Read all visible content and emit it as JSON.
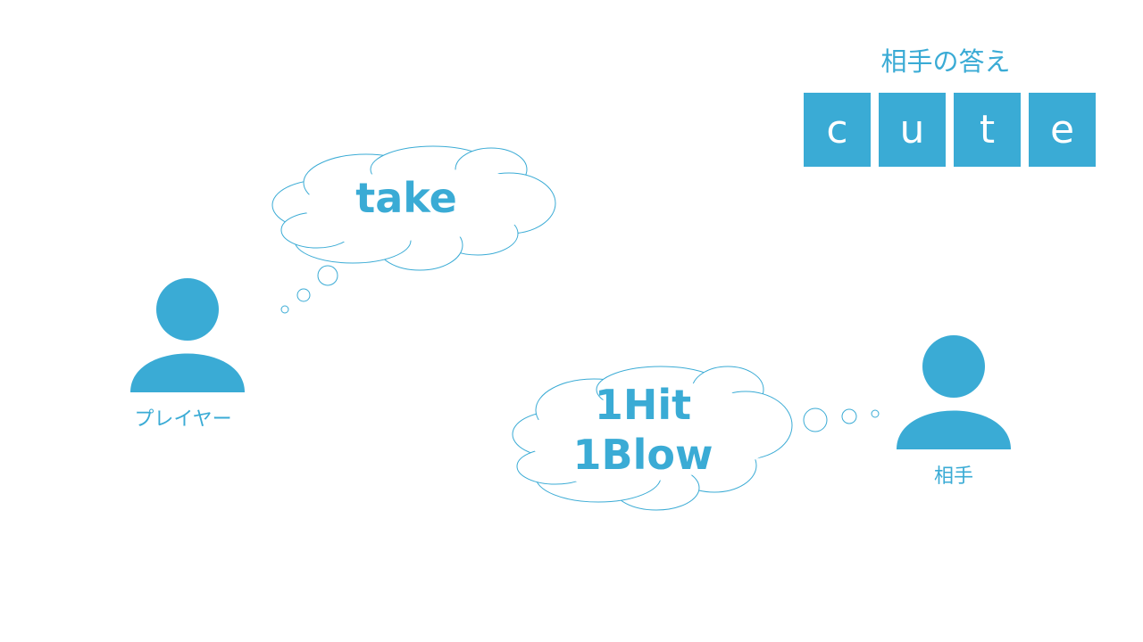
{
  "answer": {
    "title": "相手の答え",
    "letters": [
      "c",
      "u",
      "t",
      "e"
    ]
  },
  "player": {
    "label": "プレイヤー",
    "guess": "take"
  },
  "opponent": {
    "label": "相手",
    "reply_line1": "1Hit",
    "reply_line2": "1Blow"
  },
  "colors": {
    "accent": "#3aabd5",
    "background": "#ffffff"
  },
  "icons": {
    "player": "person-icon",
    "opponent": "person-icon",
    "player_thought": "thought-cloud-icon",
    "opponent_thought": "thought-cloud-icon"
  }
}
